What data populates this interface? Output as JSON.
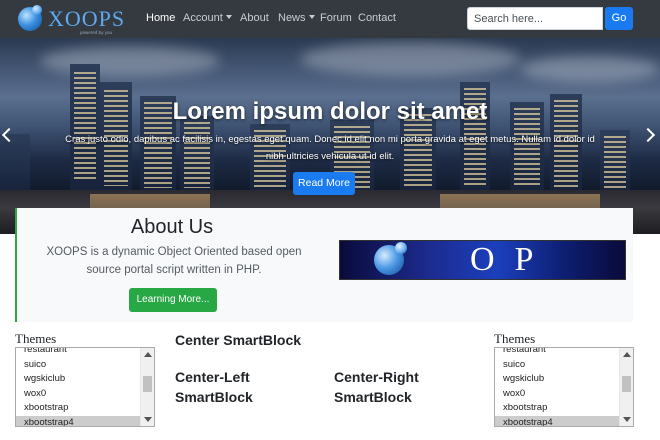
{
  "brand": {
    "name": "XOOPS",
    "tagline": "powered by you",
    "colors": {
      "navbar": "#343a40",
      "primary": "#1a7bf0",
      "success": "#28a745"
    }
  },
  "nav": {
    "items": [
      {
        "label": "Home",
        "active": true
      },
      {
        "label": "Account",
        "dropdown": true
      },
      {
        "label": "About"
      },
      {
        "label": "News",
        "dropdown": true
      },
      {
        "label": "Forum"
      },
      {
        "label": "Contact"
      }
    ]
  },
  "search": {
    "placeholder": "Search here...",
    "button_label": "Go"
  },
  "hero": {
    "title": "Lorem ipsum dolor sit amet",
    "text": "Cras justo odio, dapibus ac facilisis in, egestas eget quam. Donec id elit non mi porta gravida at eget metus. Nullam id dolor id nibh ultricies vehicula ut id elit.",
    "button_label": "Read More",
    "prev_icon": "chevron-left-icon",
    "next_icon": "chevron-right-icon"
  },
  "about": {
    "title": "About Us",
    "text": "XOOPS is a dynamic Object Oriented based open source portal script written in PHP.",
    "button_label": "Learning More...",
    "banner_text": "OP"
  },
  "blocks": {
    "left_title": "Themes",
    "right_title": "Themes",
    "center": "Center SmartBlock",
    "center_left": "Center-Left SmartBlock",
    "center_right": "Center-Right SmartBlock",
    "themes": [
      "restaurant",
      "suico",
      "wgskiclub",
      "wox0",
      "xbootstrap",
      "xbootstrap4"
    ],
    "selected_theme": "xbootstrap4"
  }
}
